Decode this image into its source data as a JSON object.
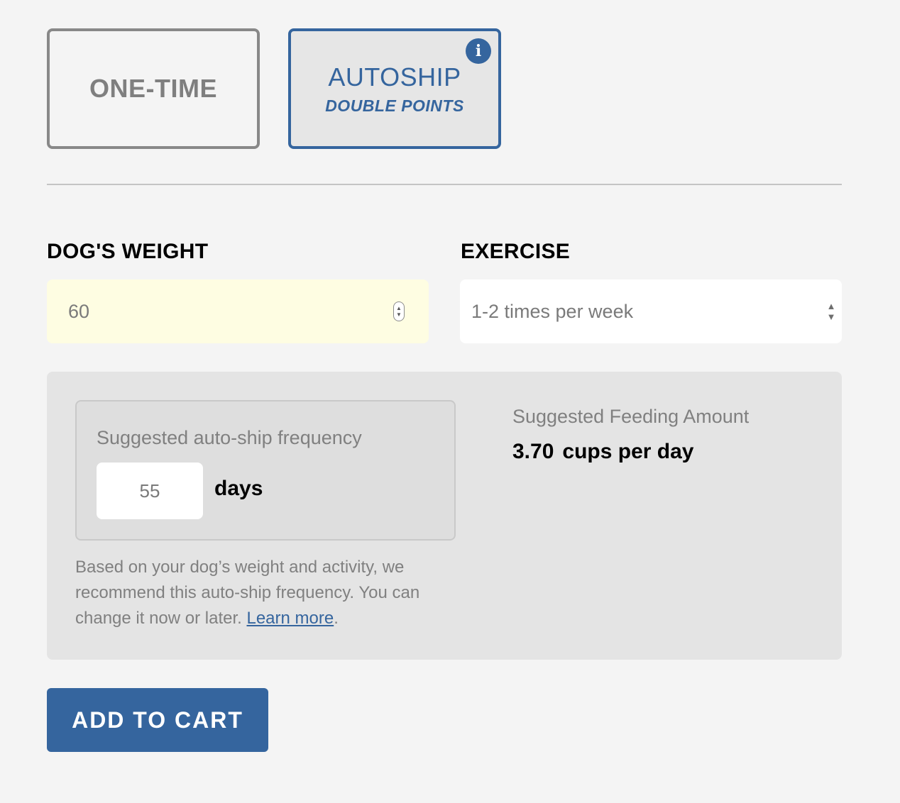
{
  "purchase_options": {
    "one_time": {
      "label": "ONE-TIME"
    },
    "autoship": {
      "label": "AUTOSHIP",
      "sublabel": "DOUBLE POINTS",
      "info_glyph": "i",
      "selected": true
    }
  },
  "fields": {
    "weight": {
      "label": "DOG'S WEIGHT",
      "value": "60"
    },
    "exercise": {
      "label": "EXERCISE",
      "value": "1-2 times per week"
    }
  },
  "suggestion": {
    "frequency": {
      "title": "Suggested auto-ship frequency",
      "value": "55",
      "unit": "days"
    },
    "note": "Based on your dog’s weight and activity, we recommend this auto-ship frequency. You can change it now or later.",
    "link_text": "Learn more",
    "note_end": ".",
    "feeding": {
      "title": "Suggested Feeding Amount",
      "amount": "3.70",
      "unit": "cups per day"
    }
  },
  "actions": {
    "add_to_cart": "ADD TO CART"
  },
  "colors": {
    "accent": "#35659e",
    "weight_field_bg": "#fefde2",
    "panel_bg": "#e4e4e4"
  },
  "icons": {
    "info": "info-icon",
    "spinner": "number-spinner-icon",
    "select": "select-arrows-icon"
  }
}
